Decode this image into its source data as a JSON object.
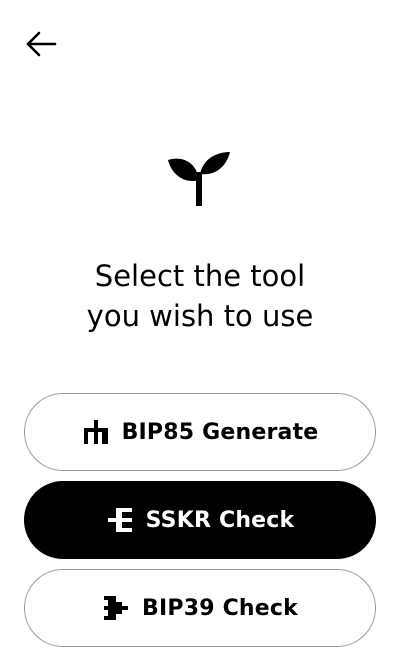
{
  "header": {
    "back_icon": "arrow-left-icon"
  },
  "logo": {
    "icon": "sprout-icon"
  },
  "title": {
    "line1": "Select the tool",
    "line2": "you wish to use"
  },
  "tools": [
    {
      "label": "BIP85 Generate",
      "icon": "bip85-icon",
      "selected": false
    },
    {
      "label": "SSKR Check",
      "icon": "sskr-icon",
      "selected": true
    },
    {
      "label": "BIP39 Check",
      "icon": "bip39-icon",
      "selected": false
    }
  ],
  "colors": {
    "background": "#ffffff",
    "foreground": "#000000",
    "border": "#9a9a9a"
  }
}
